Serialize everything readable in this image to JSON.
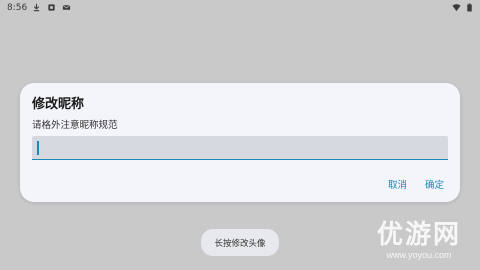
{
  "status_bar": {
    "time": "8:56",
    "left_icons": [
      "download-icon",
      "notification-app-icon",
      "mail-icon"
    ],
    "right_icons": [
      "wifi-icon",
      "battery-icon"
    ]
  },
  "dialog": {
    "title": "修改昵称",
    "message": "请格外注意昵称规范",
    "input_value": "",
    "cancel_label": "取消",
    "confirm_label": "确定"
  },
  "toast": {
    "text": "长按修改头像"
  },
  "watermark": {
    "main": "优游网",
    "sub": "www.yoyou.com"
  },
  "colors": {
    "accent": "#1a8ab4",
    "dialog_bg": "#f4f5fb",
    "scrim": "#c9c9c9"
  }
}
